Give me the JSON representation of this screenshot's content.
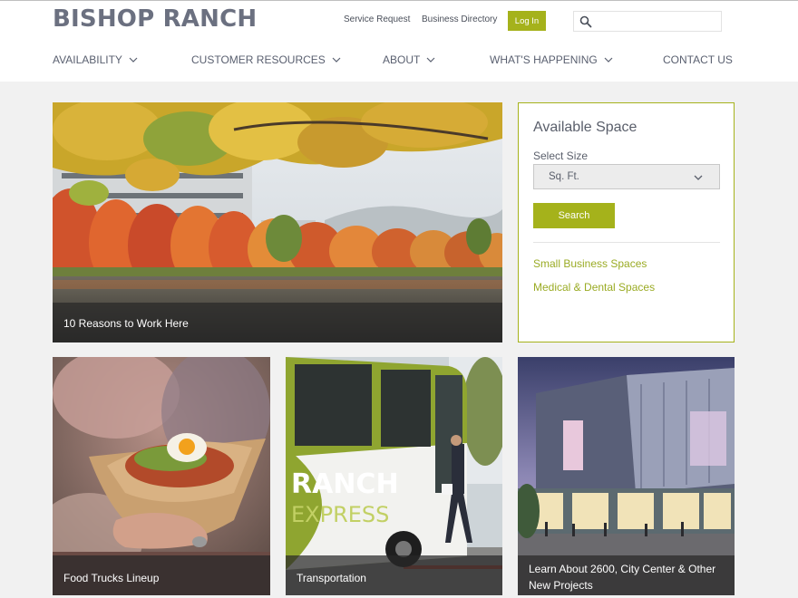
{
  "header": {
    "logo": "BISHOP RANCH",
    "utility_links": [
      "Service Request",
      "Business Directory"
    ],
    "login_label": "Log In",
    "search": {
      "placeholder": "",
      "icon": "search-icon"
    }
  },
  "nav": [
    {
      "label": "AVAILABILITY",
      "has_dropdown": true
    },
    {
      "label": "CUSTOMER RESOURCES",
      "has_dropdown": true
    },
    {
      "label": "ABOUT",
      "has_dropdown": true
    },
    {
      "label": "WHAT'S HAPPENING",
      "has_dropdown": true
    },
    {
      "label": "CONTACT US",
      "has_dropdown": false
    }
  ],
  "tiles": {
    "hero_caption": "10 Reasons to Work Here",
    "food_caption": "Food Trucks Lineup",
    "bus_caption": "Transportation",
    "city_caption": "Learn About 2600, City Center & Other New Projects"
  },
  "available_space": {
    "title": "Available Space",
    "select_label": "Select Size",
    "select_value": "Sq. Ft.",
    "search_label": "Search",
    "links": [
      "Small Business Spaces",
      "Medical & Dental Spaces"
    ]
  },
  "colors": {
    "accent_green": "#a5b21b",
    "link_green": "#9aab24",
    "text_gray": "#5a5f6b",
    "page_background": "#f1f1f1"
  }
}
